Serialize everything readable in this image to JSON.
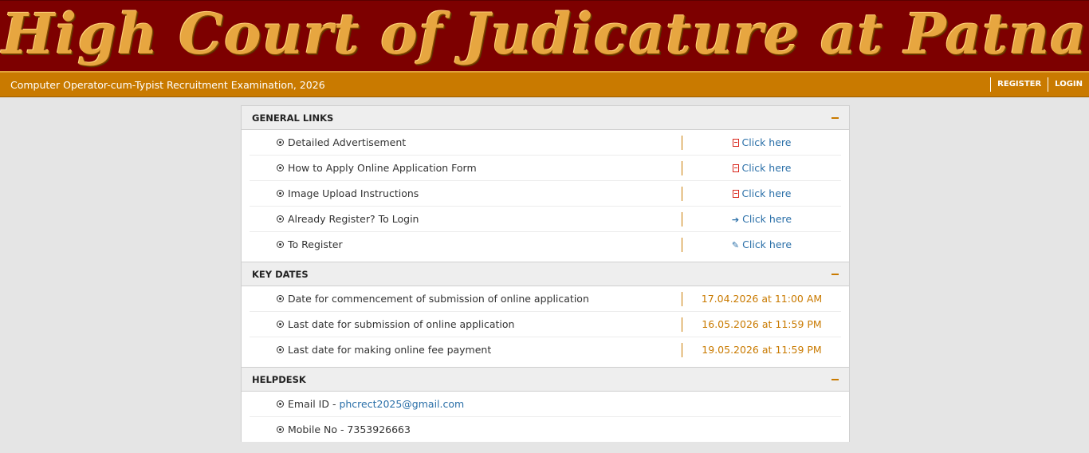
{
  "header": {
    "banner_title": "High Court of Judicature at Patna",
    "exam_title": "Computer Operator-cum-Typist Recruitment Examination, 2026",
    "nav": {
      "register": "REGISTER",
      "login": "LOGIN"
    }
  },
  "general_links": {
    "title": "GENERAL LINKS",
    "items": [
      {
        "label": "Detailed Advertisement",
        "link_text": "Click here",
        "icon": "pdf-icon"
      },
      {
        "label": "How to Apply Online Application Form",
        "link_text": "Click here",
        "icon": "pdf-icon"
      },
      {
        "label": "Image Upload Instructions",
        "link_text": "Click here",
        "icon": "pdf-icon"
      },
      {
        "label": "Already Register? To Login",
        "link_text": "Click here",
        "icon": "sign-in-icon"
      },
      {
        "label": "To Register",
        "link_text": "Click here",
        "icon": "edit-icon"
      }
    ]
  },
  "key_dates": {
    "title": "KEY DATES",
    "items": [
      {
        "label": "Date for commencement of submission of online application",
        "value": "17.04.2026 at 11:00 AM"
      },
      {
        "label": "Last date for submission of online application",
        "value": "16.05.2026 at 11:59 PM"
      },
      {
        "label": "Last date for making online fee payment",
        "value": "19.05.2026 at 11:59 PM"
      }
    ]
  },
  "helpdesk": {
    "title": "HELPDESK",
    "email_label": "Email ID - ",
    "email": "phcrect2025@gmail.com",
    "mobile": "Mobile No - 7353926663"
  },
  "colors": {
    "banner": "#7d0000",
    "accent": "#c97a00",
    "link": "#2a6fa8",
    "pdf": "#d9261c"
  }
}
